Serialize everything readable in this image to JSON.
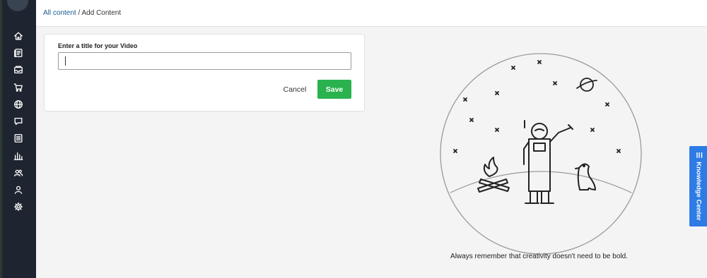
{
  "breadcrumb": {
    "root_label": "All content",
    "separator": " / ",
    "current_label": "Add Content"
  },
  "sidebar": {
    "items": [
      {
        "name": "home",
        "icon": "home-icon"
      },
      {
        "name": "content",
        "icon": "document-icon"
      },
      {
        "name": "inbox",
        "icon": "inbox-icon"
      },
      {
        "name": "store",
        "icon": "cart-icon"
      },
      {
        "name": "web",
        "icon": "globe-icon"
      },
      {
        "name": "messages",
        "icon": "chat-icon"
      },
      {
        "name": "lists",
        "icon": "list-icon"
      },
      {
        "name": "analytics",
        "icon": "bar-chart-icon"
      },
      {
        "name": "users",
        "icon": "users-icon"
      },
      {
        "name": "account",
        "icon": "user-icon"
      },
      {
        "name": "settings",
        "icon": "gear-icon"
      }
    ]
  },
  "form": {
    "title_label": "Enter a title for your Video",
    "title_value": "",
    "cancel_label": "Cancel",
    "save_label": "Save"
  },
  "illustration": {
    "caption": "Always remember that creativity doesn't need to be bold."
  },
  "knowledge_center": {
    "label": "Knowledge Center",
    "icon": "menu-icon"
  },
  "colors": {
    "sidebar_bg": "#1e2530",
    "save_button": "#2ab24e",
    "knowledge_tab": "#2d7be5",
    "link": "#1a5a96"
  }
}
